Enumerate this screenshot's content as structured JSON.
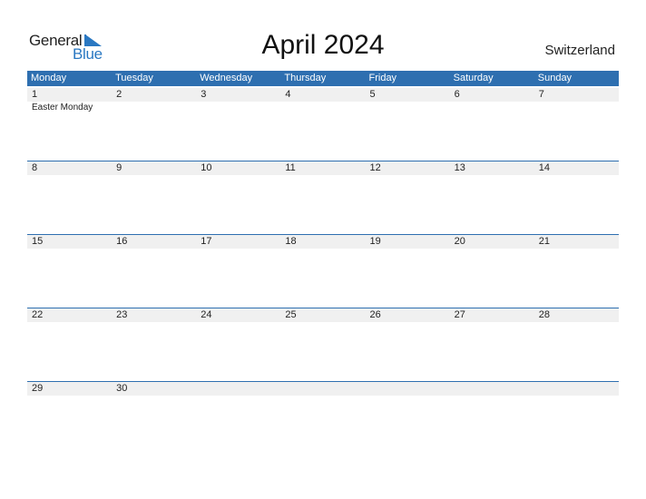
{
  "logo": {
    "word1": "General",
    "word2": "Blue"
  },
  "title": "April 2024",
  "country": "Switzerland",
  "colors": {
    "accent": "#2e6fb0",
    "band": "#f0f0f0"
  },
  "weekdays": [
    "Monday",
    "Tuesday",
    "Wednesday",
    "Thursday",
    "Friday",
    "Saturday",
    "Sunday"
  ],
  "weeks": [
    {
      "days": [
        "1",
        "2",
        "3",
        "4",
        "5",
        "6",
        "7"
      ],
      "holidays": [
        "Easter Monday",
        "",
        "",
        "",
        "",
        "",
        ""
      ]
    },
    {
      "days": [
        "8",
        "9",
        "10",
        "11",
        "12",
        "13",
        "14"
      ],
      "holidays": [
        "",
        "",
        "",
        "",
        "",
        "",
        ""
      ]
    },
    {
      "days": [
        "15",
        "16",
        "17",
        "18",
        "19",
        "20",
        "21"
      ],
      "holidays": [
        "",
        "",
        "",
        "",
        "",
        "",
        ""
      ]
    },
    {
      "days": [
        "22",
        "23",
        "24",
        "25",
        "26",
        "27",
        "28"
      ],
      "holidays": [
        "",
        "",
        "",
        "",
        "",
        "",
        ""
      ]
    },
    {
      "days": [
        "29",
        "30",
        "",
        "",
        "",
        "",
        ""
      ],
      "holidays": [
        "",
        "",
        "",
        "",
        "",
        "",
        ""
      ]
    }
  ]
}
